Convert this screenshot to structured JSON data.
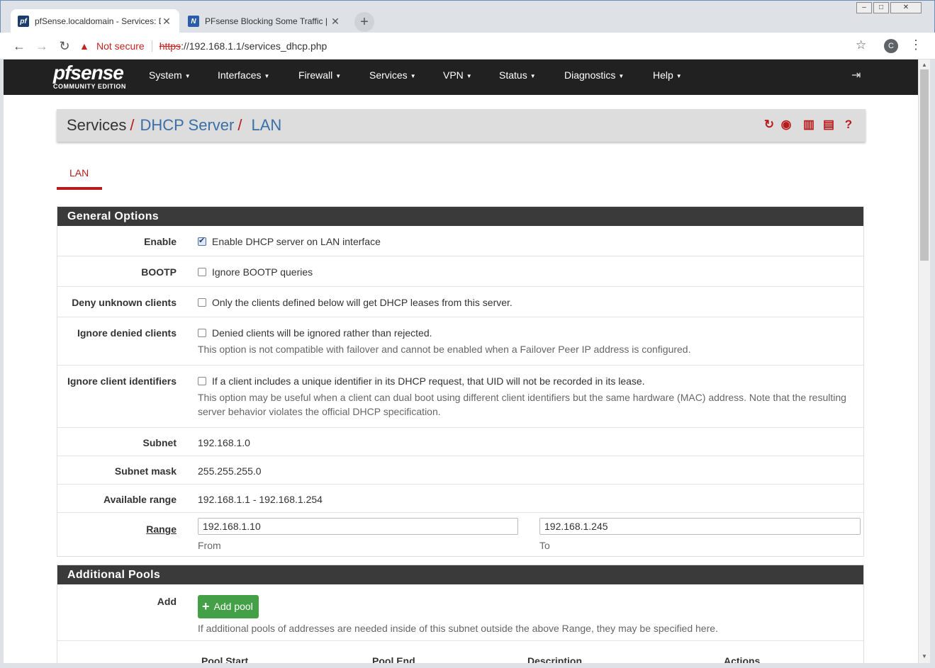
{
  "browser": {
    "tabs": [
      {
        "title": "pfSense.localdomain - Services: D",
        "favicon": "pf",
        "active": true
      },
      {
        "title": "PFsense Blocking Some Traffic | N",
        "favicon": "N",
        "active": false
      }
    ],
    "security_label": "Not secure",
    "url_scheme": "https",
    "url_rest": "://192.168.1.1/services_dhcp.php",
    "profile_initial": "C"
  },
  "navbar": {
    "logo_text": "pfsense",
    "logo_sub": "COMMUNITY EDITION",
    "menu": [
      "System",
      "Interfaces",
      "Firewall",
      "Services",
      "VPN",
      "Status",
      "Diagnostics",
      "Help"
    ]
  },
  "breadcrumb": {
    "part1": "Services",
    "part2": "DHCP Server",
    "part3": "LAN",
    "sep": "/"
  },
  "tabs": [
    "LAN"
  ],
  "general": {
    "heading": "General Options",
    "enable_label": "Enable",
    "enable_text": "Enable DHCP server on LAN interface",
    "enable_checked": true,
    "bootp_label": "BOOTP",
    "bootp_text": "Ignore BOOTP queries",
    "deny_label": "Deny unknown clients",
    "deny_text": "Only the clients defined below will get DHCP leases from this server.",
    "ignore_denied_label": "Ignore denied clients",
    "ignore_denied_text": "Denied clients will be ignored rather than rejected.",
    "ignore_denied_help": "This option is not compatible with failover and cannot be enabled when a Failover Peer IP address is configured.",
    "ignore_uid_label": "Ignore client identifiers",
    "ignore_uid_text": "If a client includes a unique identifier in its DHCP request, that UID will not be recorded in its lease.",
    "ignore_uid_help": "This option may be useful when a client can dual boot using different client identifiers but the same hardware (MAC) address. Note that the resulting server behavior violates the official DHCP specification.",
    "subnet_label": "Subnet",
    "subnet_value": "192.168.1.0",
    "mask_label": "Subnet mask",
    "mask_value": "255.255.255.0",
    "avail_label": "Available range",
    "avail_value": "192.168.1.1 - 192.168.1.254",
    "range_label": "Range",
    "range_from": "192.168.1.10",
    "range_to": "192.168.1.245",
    "from_label": "From",
    "to_label": "To"
  },
  "pools": {
    "heading": "Additional Pools",
    "add_label": "Add",
    "add_button": "Add pool",
    "help": "If additional pools of addresses are needed inside of this subnet outside the above Range, they may be specified here.",
    "columns": [
      "Pool Start",
      "Pool End",
      "Description",
      "Actions"
    ]
  },
  "colors": {
    "accent_red": "#b71c1c",
    "link_blue": "#3b6fa7",
    "navbar_bg": "#212121",
    "success_green": "#43a047"
  }
}
